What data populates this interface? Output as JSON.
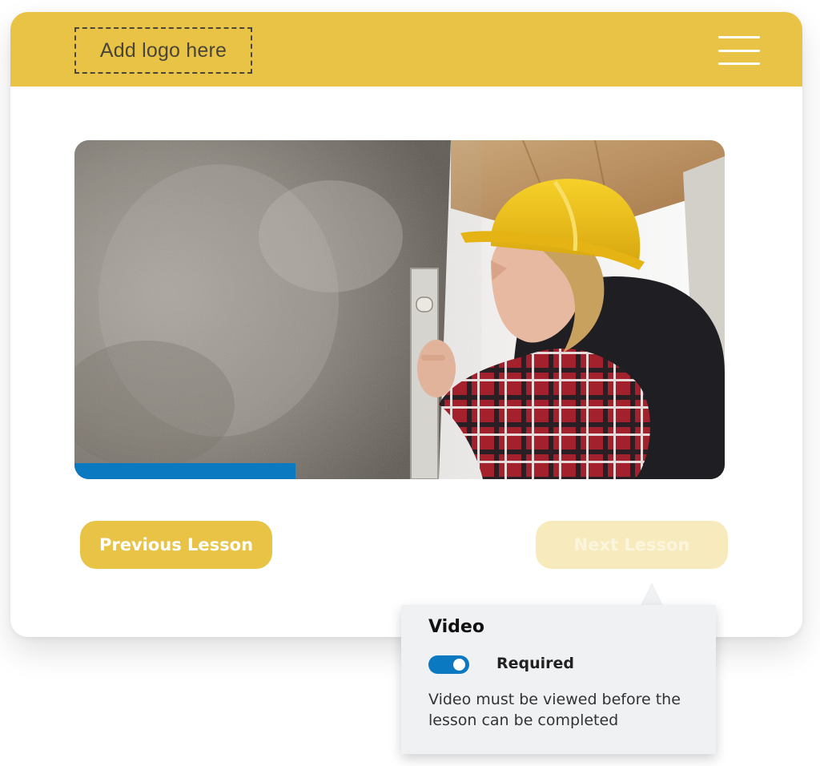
{
  "header": {
    "logo_placeholder": "Add logo here",
    "menu_icon": "hamburger-menu-icon",
    "background_color": "#e8c346"
  },
  "video": {
    "subject": "worker-in-hard-hat-with-spirit-level",
    "progress_percent": 34,
    "progress_color": "#0b78c2"
  },
  "navigation": {
    "previous_label": "Previous Lesson",
    "next_label": "Next Lesson",
    "next_state": "disabled"
  },
  "popover": {
    "title": "Video",
    "toggle_on": true,
    "toggle_label": "Required",
    "description": "Video must be viewed before the lesson can be completed"
  }
}
